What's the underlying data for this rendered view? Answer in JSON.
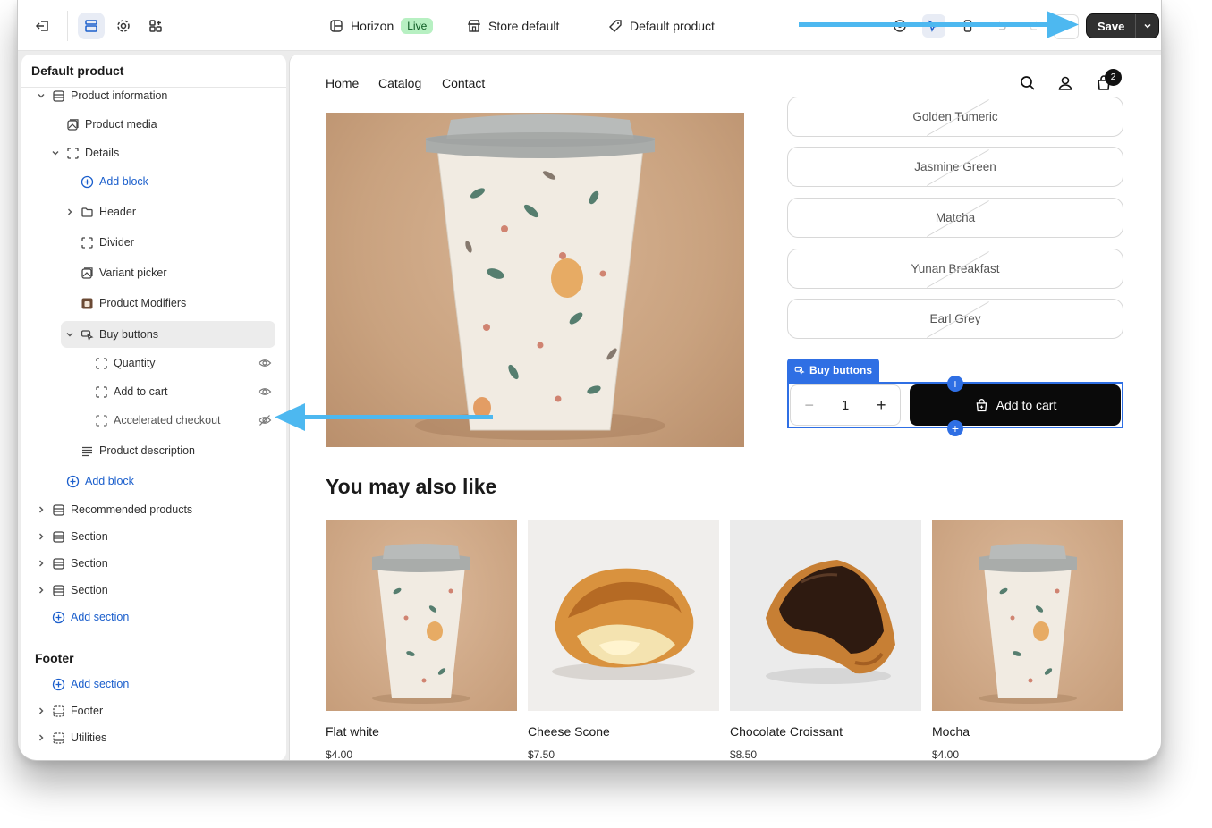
{
  "topbar": {
    "theme_name": "Horizon",
    "live_badge": "Live",
    "store_label": "Store default",
    "template_label": "Default product",
    "save_label": "Save"
  },
  "sidebar": {
    "title": "Default product",
    "tree": [
      {
        "label": "Product information",
        "icon": "section-icon"
      },
      {
        "label": "Product media",
        "icon": "media-icon"
      },
      {
        "label": "Details",
        "icon": "block-icon"
      },
      {
        "label": "Add block",
        "icon": "add-circle-icon"
      },
      {
        "label": "Header",
        "icon": "folder-icon"
      },
      {
        "label": "Divider",
        "icon": "block-icon"
      },
      {
        "label": "Variant picker",
        "icon": "media-icon"
      },
      {
        "label": "Product Modifiers",
        "icon": "app-icon"
      },
      {
        "label": "Buy buttons",
        "icon": "cursor-icon"
      },
      {
        "label": "Quantity",
        "icon": "block-icon"
      },
      {
        "label": "Add to cart",
        "icon": "block-icon"
      },
      {
        "label": "Accelerated checkout",
        "icon": "block-icon"
      },
      {
        "label": "Product description",
        "icon": "text-icon"
      },
      {
        "label": "Add block",
        "icon": "add-circle-icon"
      },
      {
        "label": "Recommended products",
        "icon": "section-icon"
      },
      {
        "label": "Section",
        "icon": "section-icon"
      },
      {
        "label": "Section",
        "icon": "section-icon"
      },
      {
        "label": "Section",
        "icon": "section-icon"
      },
      {
        "label": "Add section",
        "icon": "add-circle-icon"
      }
    ],
    "footer_title": "Footer",
    "footer_tree": [
      {
        "label": "Add section",
        "icon": "add-circle-icon"
      },
      {
        "label": "Footer",
        "icon": "footer-icon"
      },
      {
        "label": "Utilities",
        "icon": "footer-icon"
      }
    ]
  },
  "preview": {
    "nav": [
      "Home",
      "Catalog",
      "Contact"
    ],
    "cart_count": "2",
    "variants": [
      "Golden Tumeric",
      "Jasmine Green",
      "Matcha",
      "Yunan Breakfast",
      "Earl Grey"
    ],
    "buy_buttons_tag": "Buy buttons",
    "quantity": "1",
    "add_to_cart": "Add to cart",
    "also_like_heading": "You may also like",
    "products": [
      {
        "name": "Flat white",
        "price": "$4.00"
      },
      {
        "name": "Cheese Scone",
        "price": "$7.50"
      },
      {
        "name": "Chocolate Croissant",
        "price": "$8.50"
      },
      {
        "name": "Mocha",
        "price": "$4.00"
      }
    ]
  },
  "colors": {
    "accent_blue": "#2f6fe4",
    "link_blue": "#1a5ecc",
    "annotation_arrow": "#4db8f0",
    "live_badge_bg": "#b7f0c2"
  }
}
